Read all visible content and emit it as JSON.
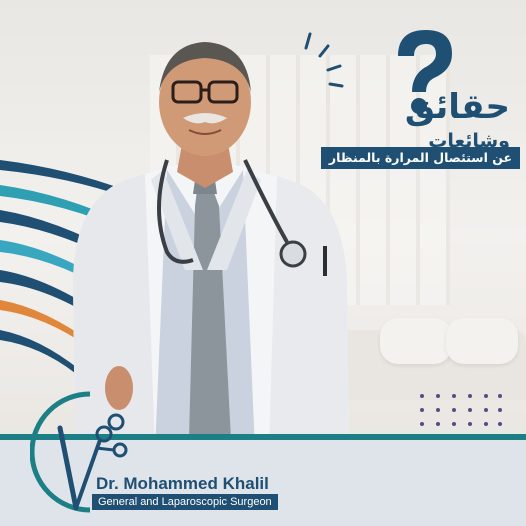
{
  "headline": {
    "title": "حقائق",
    "subtitle": "وشائعات",
    "banner": "عن استئصال المرارة بالمنظار"
  },
  "doctor": {
    "name": "Dr. Mohammed Khalil",
    "role": "General and Laparoscopic Surgeon"
  },
  "colors": {
    "navy": "#1f4f72",
    "teal": "#1d7f86",
    "footer_bg": "#dfe4ea"
  },
  "icons": [
    "question-mark-icon",
    "laparoscopic-instrument-logo-icon",
    "stethoscope-icon"
  ]
}
